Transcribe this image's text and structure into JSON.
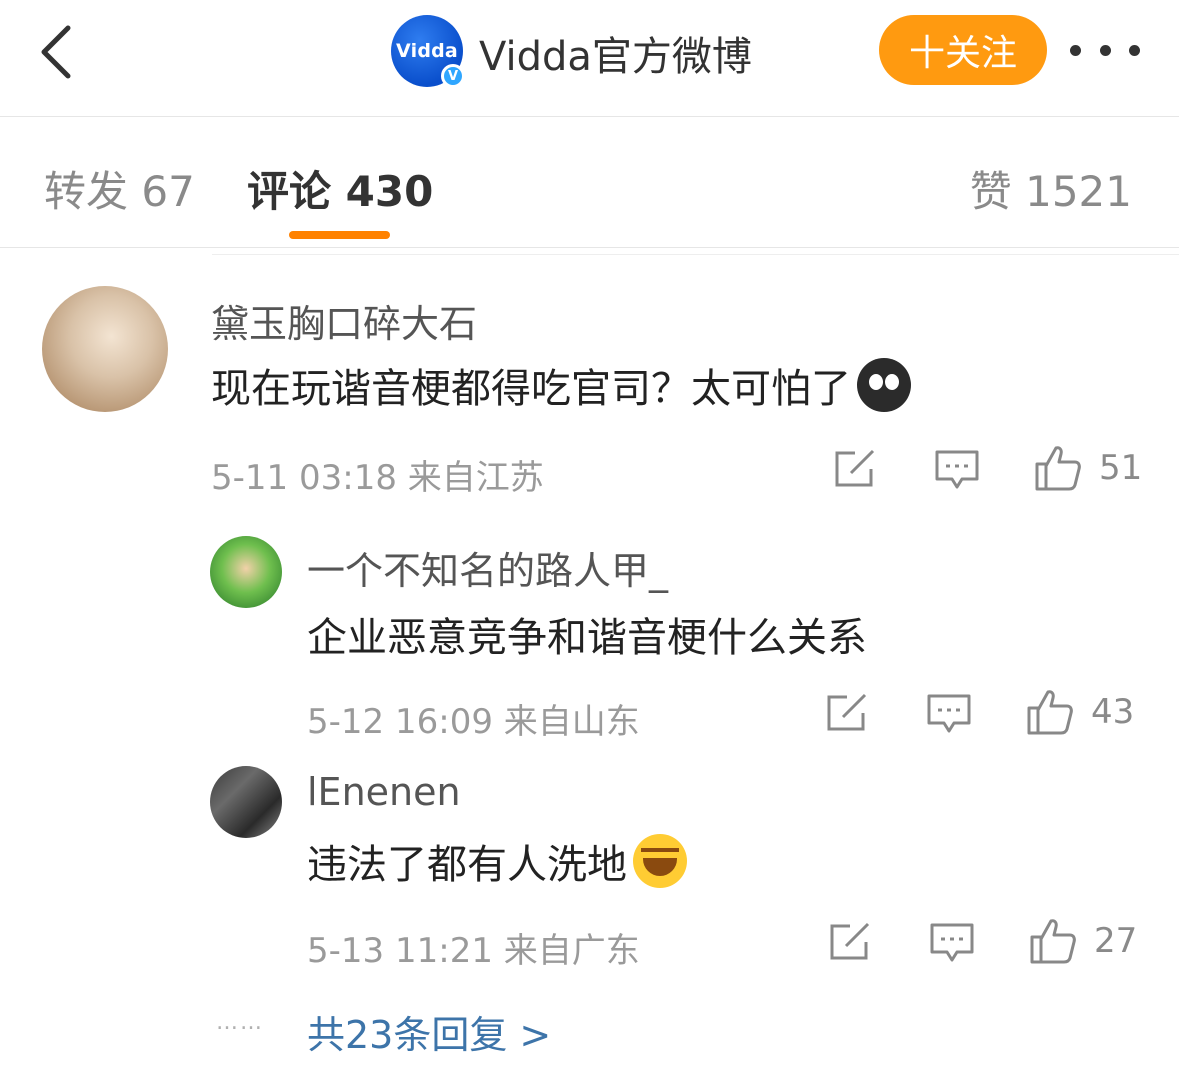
{
  "header": {
    "account_name": "Vidda官方微博",
    "avatar_text": "Vidda",
    "verified_mark": "V",
    "follow_label": "十关注"
  },
  "tabs": [
    {
      "label": "转发 67"
    },
    {
      "label": "评论 430"
    },
    {
      "label": "赞 1521"
    }
  ],
  "comments": [
    {
      "author": "黛玉胸口碎大石",
      "text": "现在玩谐音梗都得吃官司？太可怕了",
      "emoji": "scared-emoji",
      "meta": "5-11 03:18  来自江苏",
      "likes": "51"
    }
  ],
  "replies": [
    {
      "author": "一个不知名的路人甲_",
      "text": "企业恶意竞争和谐音梗什么关系",
      "meta": "5-12 16:09  来自山东",
      "likes": "43"
    },
    {
      "author": "lEnenen",
      "text": "违法了都有人洗地",
      "emoji": "laughing-tears-emoji",
      "meta": "5-13 11:21  来自广东",
      "likes": "27"
    }
  ],
  "more_replies": {
    "dots": "……",
    "label": "共23条回复 >"
  },
  "colors": {
    "accent": "#ff8200",
    "follow_button": "#ff9a10",
    "link": "#3d74a9"
  }
}
